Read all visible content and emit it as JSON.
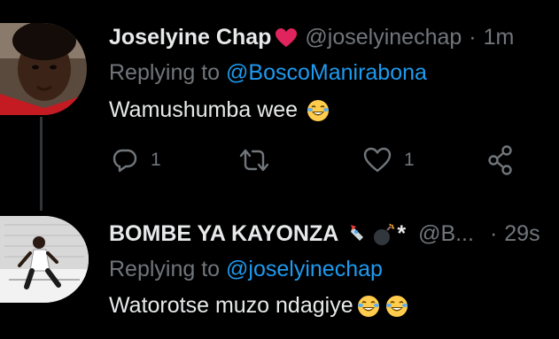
{
  "tweets": [
    {
      "display_name": "Joselyine Chap",
      "name_emoji": "heart-icon",
      "handle": "@joselyinechap",
      "separator": "·",
      "time": "1m",
      "replying_prefix": "Replying to",
      "replying_to": "@BoscoManirabona",
      "text": "Wamushumba wee",
      "text_emoji": "face-with-tears-of-joy-icon",
      "reply_count": "1",
      "like_count": "1"
    },
    {
      "display_name": "BOMBE YA KAYONZA",
      "name_emoji": "rocket-bomb-sparkle-icons",
      "name_suffix": "*",
      "handle": "@B...",
      "separator": "·",
      "time": "29s",
      "replying_prefix": "Replying to",
      "replying_to": "@joselyinechap",
      "text": "Watorotse muzo ndagiye",
      "text_emoji": "face-with-tears-of-joy-icon"
    }
  ],
  "colors": {
    "background": "#000000",
    "primary_text": "#e7e9ea",
    "secondary_text": "#71767b",
    "link": "#1d9bf0",
    "thread_line": "#333639"
  }
}
